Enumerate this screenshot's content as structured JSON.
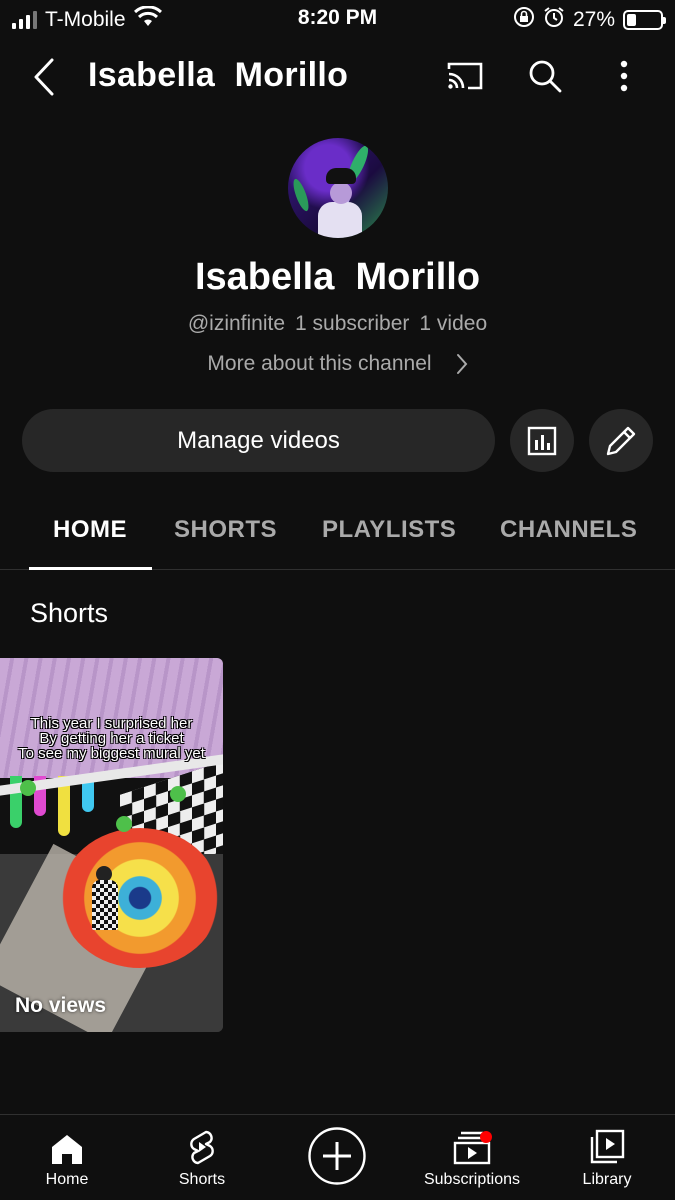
{
  "status_bar": {
    "carrier": "T-Mobile",
    "time": "8:20 PM",
    "battery": "27%",
    "battery_level": 0.27,
    "signal_icon": "signal-bars-icon",
    "wifi_icon": "wifi-icon",
    "alarm_icon": "alarm-icon",
    "lock_icon": "rotation-lock-icon"
  },
  "app_bar": {
    "title": "Isabella  Morillo",
    "back_icon": "back-chevron-icon",
    "cast_icon": "cast-icon",
    "search_icon": "search-icon",
    "more_icon": "more-vertical-icon"
  },
  "channel": {
    "name": "Isabella  Morillo",
    "handle": "@izinfinite",
    "subscribers": "1 subscriber",
    "videos": "1 video",
    "more_about": "More about this channel"
  },
  "actions": {
    "manage_videos": "Manage videos",
    "analytics_icon": "analytics-icon",
    "edit_icon": "pencil-icon"
  },
  "tabs": [
    {
      "label": "HOME",
      "active": true
    },
    {
      "label": "SHORTS",
      "active": false
    },
    {
      "label": "PLAYLISTS",
      "active": false
    },
    {
      "label": "CHANNELS",
      "active": false
    }
  ],
  "shorts_section": {
    "title": "Shorts",
    "items": [
      {
        "caption_lines": [
          "This year I surprised her",
          "By getting her a ticket",
          "To see my biggest mural yet"
        ],
        "views": "No views"
      }
    ]
  },
  "bottom_nav": [
    {
      "label": "Home",
      "icon": "home-icon"
    },
    {
      "label": "Shorts",
      "icon": "shorts-icon"
    },
    {
      "label": "",
      "icon": "create-plus-icon"
    },
    {
      "label": "Subscriptions",
      "icon": "subscriptions-icon"
    },
    {
      "label": "Library",
      "icon": "library-icon"
    }
  ],
  "colors": {
    "background": "#0f0f0f",
    "surface": "#272727",
    "secondary_text": "#aaaaaa",
    "notification": "#ff0000"
  }
}
